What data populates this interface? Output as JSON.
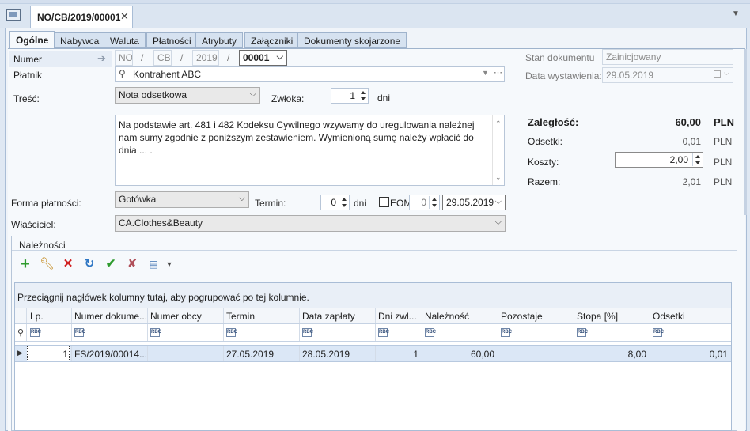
{
  "window": {
    "doc_tab_title": "NO/CB/2019/00001",
    "close_glyph": "✕"
  },
  "tabs": [
    "Ogólne",
    "Nabywca",
    "Waluta",
    "Płatności",
    "Atrybuty",
    "Załączniki",
    "Dokumenty skojarzone"
  ],
  "form": {
    "numer_label": "Numer",
    "numer_parts": [
      "NO",
      "/",
      "CB",
      "/",
      "2019",
      "/"
    ],
    "numer_value": "00001",
    "platnik_label": "Płatnik",
    "platnik_value": "Kontrahent ABC",
    "tresc_label": "Treść:",
    "tresc_value": "Nota odsetkowa",
    "zwloka_label": "Zwłoka:",
    "zwloka_value": "1",
    "zwloka_unit": "dni",
    "body_text": "Na podstawie art. 481 i 482 Kodeksu Cywilnego wzywamy do uregulowania należnej nam sumy zgodnie z poniższym zestawieniem. Wymienioną sumę należy wpłacić do dnia ...  .",
    "forma_label": "Forma płatności:",
    "forma_value": "Gotówka",
    "termin_label": "Termin:",
    "termin_days": "0",
    "termin_unit": "dni",
    "eom_label": "EOM",
    "eom_value": "0",
    "termin_date": "29.05.2019",
    "wlasciciel_label": "Właściciel:",
    "wlasciciel_value": "CA.Clothes&Beauty"
  },
  "status": {
    "stan_label": "Stan dokumentu",
    "stan_value": "Zainicjowany",
    "data_label": "Data wystawienia:",
    "data_value": "29.05.2019"
  },
  "summary": {
    "zaleglosc_label": "Zaległość:",
    "zaleglosc_value": "60,00",
    "odsetki_label": "Odsetki:",
    "odsetki_value": "0,01",
    "koszty_label": "Koszty:",
    "koszty_value": "2,00",
    "razem_label": "Razem:",
    "razem_value": "2,01",
    "currency": "PLN"
  },
  "naleznosci": {
    "group_title": "Należności",
    "group_hint": "Przeciągnij nagłówek kolumny tutaj, aby pogrupować po tej kolumnie.",
    "filter_tag": "RBC",
    "columns": [
      "Lp.",
      "Numer dokume...",
      "Numer obcy",
      "Termin",
      "Data zapłaty",
      "Dni zwł...",
      "Należność",
      "Pozostaje",
      "Stopa [%]",
      "Odsetki"
    ],
    "rows": [
      [
        "1",
        "FS/2019/00014...",
        "",
        "27.05.2019",
        "28.05.2019",
        "1",
        "60,00",
        "",
        "8,00",
        "0,01"
      ]
    ]
  },
  "colors": {
    "accent": "#dfe8f3",
    "add_icon": "#2e9b2e",
    "delete_icon": "#d02020"
  }
}
